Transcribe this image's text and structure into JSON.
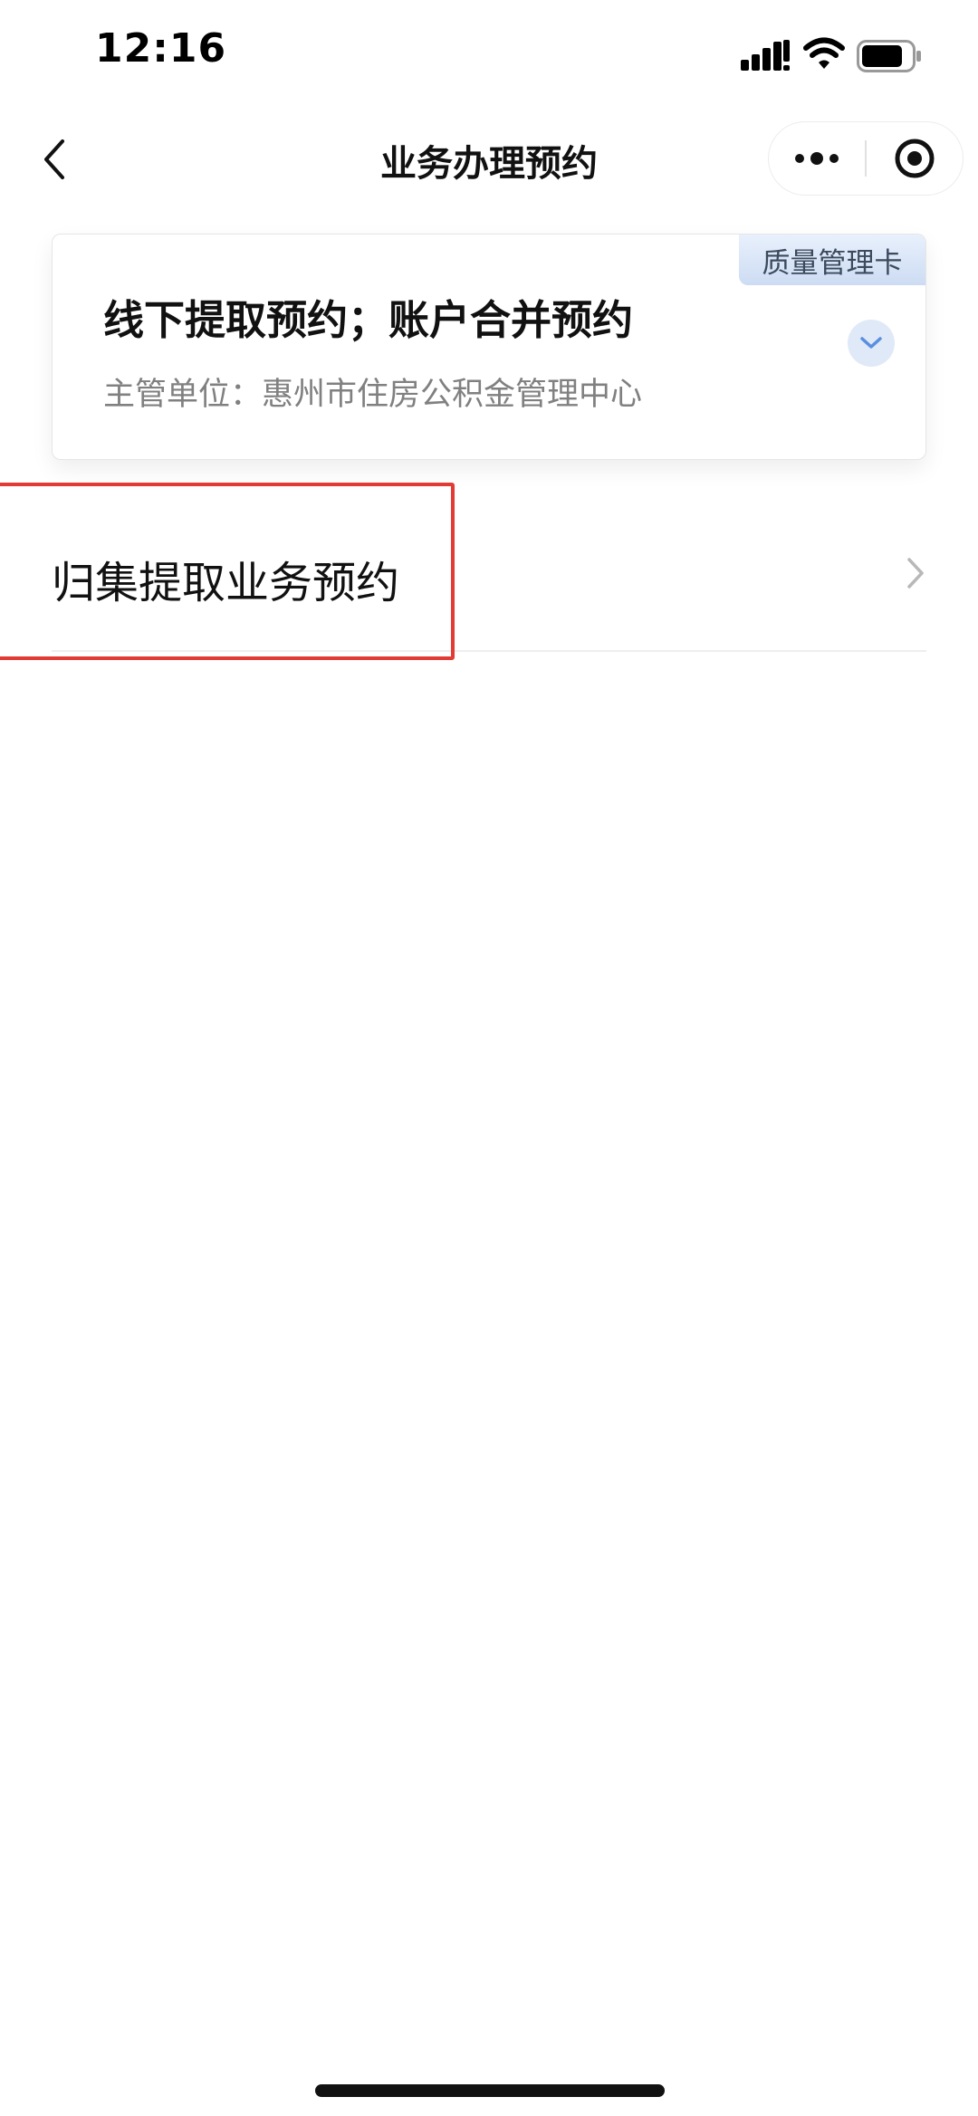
{
  "status_bar": {
    "time": "12:16",
    "icons": [
      "signal-icon",
      "wifi-icon",
      "battery-icon"
    ]
  },
  "nav": {
    "title": "业务办理预约",
    "back_icon": "chevron-left-icon",
    "more_icon": "more-dots-icon",
    "close_icon": "target-circle-icon"
  },
  "card": {
    "tag": "质量管理卡",
    "title": "线下提取预约；账户合并预约",
    "subtitle": "主管单位：惠州市住房公积金管理中心",
    "expand_icon": "chevron-down-icon"
  },
  "list": {
    "items": [
      {
        "label": "归集提取业务预约",
        "icon": "chevron-right-icon"
      }
    ]
  },
  "colors": {
    "highlight": "#e23b35",
    "tag_bg": "#cddcf3",
    "expand_bg": "#dfe9f8",
    "accent": "#5a8fe0"
  }
}
